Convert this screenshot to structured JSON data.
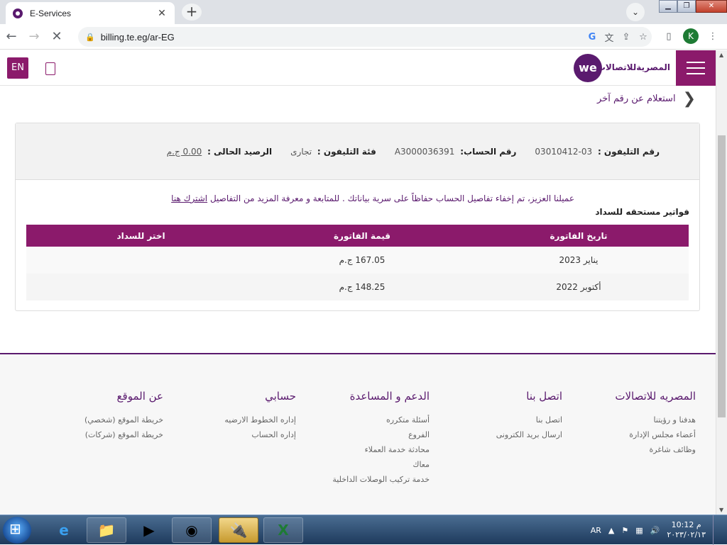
{
  "browser": {
    "tab_title": "E-Services",
    "url": "billing.te.eg/ar-EG"
  },
  "header": {
    "lang_button": "EN",
    "brand_text": "المصريةللاتصالات",
    "logo_text": "we"
  },
  "page": {
    "back_link": "استعلام عن رقم آخر",
    "info": {
      "phone_label": "رقم التليفون :",
      "phone_value": "03-03010412",
      "account_label": "رقم الحساب:",
      "account_value": "A3000036391",
      "category_label": "فئة التليفون :",
      "category_value": "تجارى",
      "balance_label": "الرصيد الحالى :",
      "balance_value": "0.00 ج.م"
    },
    "notice_text": "عميلنا العزيز، تم إخفاء تفاصيل الحساب حفاظاً على سرية بياناتك . للمتابعة و معرفة المزيد من التفاصيل",
    "notice_link": "اشترك هنا",
    "bills_title": "فواتير مستحقه للسداد",
    "bills_headers": [
      "تاريخ الفاتورة",
      "قيمة الفاتورة",
      "اختر للسداد"
    ],
    "bills": [
      {
        "date": "يناير 2023",
        "amount": "167.05 ج.م"
      },
      {
        "date": "أكتوبر 2022",
        "amount": "148.25 ج.م"
      }
    ]
  },
  "footer": {
    "columns": [
      {
        "title": "المصريه للاتصالات",
        "links": [
          "هدفنا و رؤيتنا",
          "أعضاء مجلس الإدارة",
          "وظائف شاغرة"
        ]
      },
      {
        "title": "اتصل بنا",
        "links": [
          "اتصل بنا",
          "ارسال بريد الكترونى"
        ]
      },
      {
        "title": "الدعم و المساعدة",
        "links": [
          "أسئلة متكرره",
          "الفروع",
          "محادثة خدمة العملاء",
          "معاك",
          "خدمة تركيب الوصلات الداخلية"
        ]
      },
      {
        "title": "حسابي",
        "links": [
          "إداره الخطوط الارضيه",
          "إداره الحساب"
        ]
      },
      {
        "title": "عن الموقع",
        "links": [
          "خريطة الموقع (شخصي)",
          "خريطة الموقع (شركات)"
        ]
      }
    ]
  },
  "taskbar": {
    "language": "AR",
    "time": "10:12 م",
    "date": "٢٠٢٣/٠٢/١٣"
  }
}
